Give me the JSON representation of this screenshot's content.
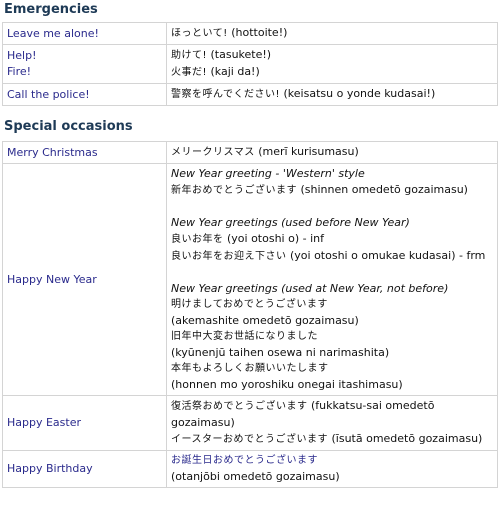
{
  "sections": [
    {
      "title": "Emergencies",
      "rows": [
        {
          "en": [
            "Leave me alone!"
          ],
          "jp": [
            {
              "ja": "ほっといて!",
              "ro": " (hottoite!)"
            }
          ]
        },
        {
          "en": [
            "Help!",
            "Fire!"
          ],
          "jp": [
            {
              "ja": "助けて!",
              "ro": " (tasukete!)"
            },
            {
              "ja": "火事だ!",
              "ro": " (kaji da!)"
            }
          ]
        },
        {
          "en": [
            "Call the police!"
          ],
          "jp": [
            {
              "ja": "警察を呼んでください!",
              "ro": " (keisatsu o yonde kudasai!)"
            }
          ]
        }
      ]
    },
    {
      "title": "Special occasions",
      "christmas": {
        "en": "Merry Christmas",
        "ja": "メリークリスマス",
        "ro": " (merī kurisumasu)"
      },
      "newyear": {
        "en": "Happy New Year",
        "western_label": "New Year greeting - 'Western' style",
        "western_ja": "新年おめでとうございます",
        "western_ro": " (shinnen omedetō gozaimasu)",
        "before_label": "New Year greetings (used before New Year)",
        "before_1_ja": "良いお年を",
        "before_1_ro": " (yoi otoshi o) - inf",
        "before_2_ja": "良いお年をお迎え下さい",
        "before_2_ro": " (yoi otoshi o omukae kudasai) - frm",
        "at_label": "New Year greetings (used at New Year, not before)",
        "at_1_ja": "明けましておめでとうございます",
        "at_1_ro": "(akemashite omedetō gozaimasu)",
        "at_2_ja": "旧年中大変お世話になりました",
        "at_2_ro": "(kyūnenjū taihen osewa ni narimashita)",
        "at_3_ja": "本年もよろしくお願いいたします",
        "at_3_ro": "(honnen mo yoroshiku onegai itashimasu)"
      },
      "easter": {
        "en": "Happy Easter",
        "l1_ja": "復活祭おめでとうございます",
        "l1_ro": " (fukkatsu-sai omedetō gozaimasu)",
        "l2_ja": "イースターおめでとうございます",
        "l2_ro": " (īsutā omedetō gozaimasu)"
      },
      "birthday": {
        "en": "Happy Birthday",
        "ja": "お誕生日おめでとうございます",
        "ro": "(otanjōbi omedetō gozaimasu)"
      }
    }
  ],
  "colors": {
    "heading": "#1e3a56",
    "english": "#2a2a8c",
    "border": "#d4d4d4"
  }
}
